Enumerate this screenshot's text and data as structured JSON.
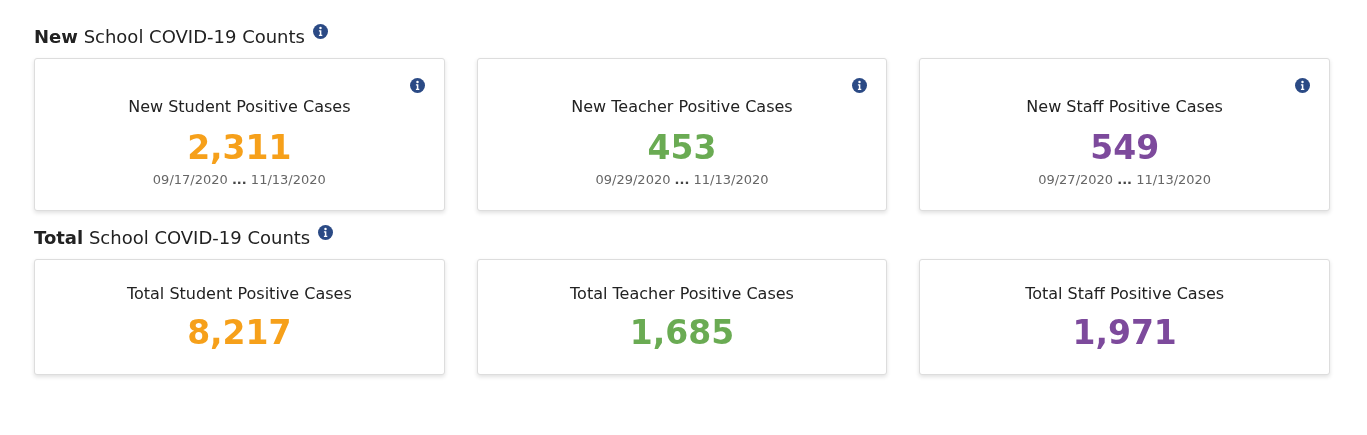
{
  "sections": [
    {
      "title": "**New** School COVID-19 Counts",
      "info": true,
      "cards": [
        {
          "label": "New Student Positive Cases",
          "value": "2,311",
          "color": "#f6a01a",
          "dates": "09/17/2020 **...** 11/13/2020",
          "info": true
        },
        {
          "label": "New Teacher Positive Cases",
          "value": "453",
          "color": "#6aab53",
          "dates": "09/29/2020 **...** 11/13/2020",
          "info": true
        },
        {
          "label": "New Staff Positive Cases",
          "value": "549",
          "color": "#7d4a9c",
          "dates": "09/27/2020 **...** 11/13/2020",
          "info": true
        }
      ]
    },
    {
      "title": "**Total** School COVID-19 Counts",
      "info": true,
      "cards": [
        {
          "label": "Total Student Positive Cases",
          "value": "8,217",
          "color": "#f6a01a",
          "info": false
        },
        {
          "label": "Total Teacher Positive Cases",
          "value": "1,685",
          "color": "#6aab53",
          "info": false
        },
        {
          "label": "Total Staff Positive Cases",
          "value": "1,971",
          "color": "#7d4a9c",
          "info": false
        }
      ]
    }
  ]
}
